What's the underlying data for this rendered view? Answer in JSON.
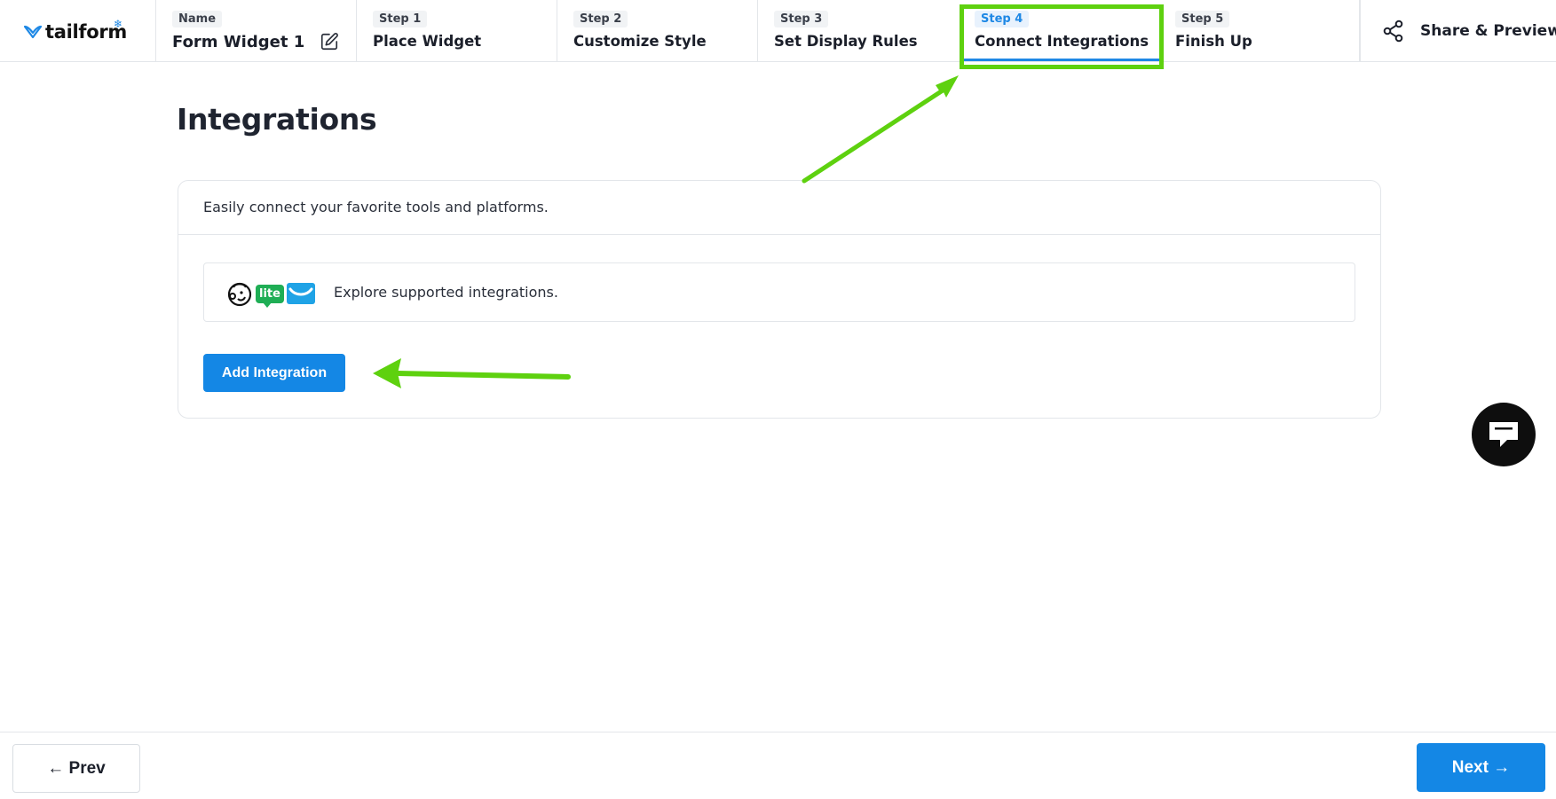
{
  "brand": {
    "name": "tailform",
    "accent": "#1e88e5",
    "highlight": "#5ed10f"
  },
  "header": {
    "name": {
      "label": "Name",
      "value": "Form Widget 1"
    },
    "steps": [
      {
        "label": "Step 1",
        "title": "Place Widget"
      },
      {
        "label": "Step 2",
        "title": "Customize Style"
      },
      {
        "label": "Step 3",
        "title": "Set Display Rules"
      },
      {
        "label": "Step 4",
        "title": "Connect Integrations",
        "active": true
      },
      {
        "label": "Step 5",
        "title": "Finish Up"
      }
    ],
    "share_label": "Share & Preview"
  },
  "main": {
    "title": "Integrations",
    "card": {
      "description": "Easily connect your favorite tools and platforms.",
      "explore": {
        "logos": [
          "mailchimp-logo",
          "mailerlite-logo",
          "getresponse-logo"
        ],
        "lite_badge": "lite",
        "text": "Explore supported integrations."
      },
      "add_button": "Add Integration"
    }
  },
  "footer": {
    "prev_label": "← Prev",
    "next_label": "Next →"
  }
}
